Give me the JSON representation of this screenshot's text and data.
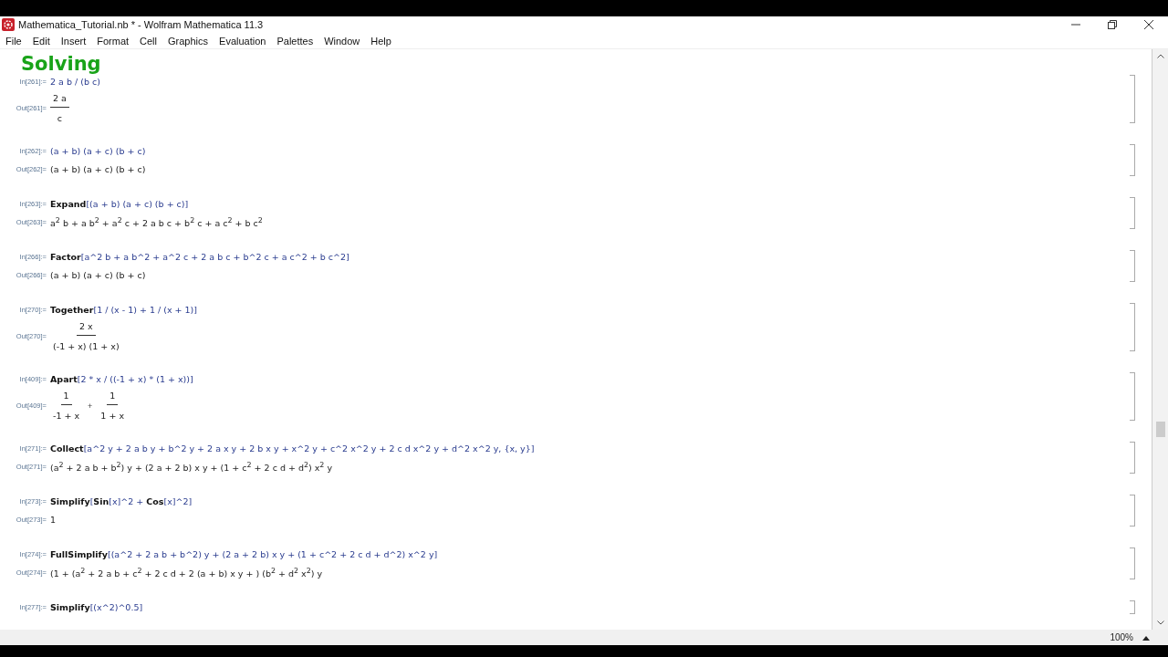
{
  "window": {
    "title": "Mathematica_Tutorial.nb * - Wolfram Mathematica 11.3"
  },
  "menu": [
    "File",
    "Edit",
    "Insert",
    "Format",
    "Cell",
    "Graphics",
    "Evaluation",
    "Palettes",
    "Window",
    "Help"
  ],
  "section_title": "Solving",
  "cells": [
    {
      "in_label": "In[261]:=",
      "input": [
        {
          "text": "2 a b / (b c)",
          "kind": "sym"
        }
      ],
      "out_label": "Out[261]=",
      "output": {
        "kind": "fractions",
        "terms": [
          {
            "num": "2 a",
            "den": "c"
          }
        ]
      }
    },
    {
      "in_label": "In[262]:=",
      "input": [
        {
          "text": "(a + b)  (a + c)  (b + c)",
          "kind": "sym"
        }
      ],
      "out_label": "Out[262]=",
      "output": {
        "kind": "line",
        "text": "(a + b) (a + c) (b + c)"
      }
    },
    {
      "in_label": "In[263]:=",
      "input": [
        {
          "text": "Expand",
          "kind": "func"
        },
        {
          "text": "[(a + b)  (a + c)  (b + c)]",
          "kind": "sym"
        }
      ],
      "out_label": "Out[263]=",
      "output": {
        "kind": "line",
        "text": "a$^{2}$ b + a b$^{2}$ + a$^{2}$ c + 2 a b c + b$^{2}$ c + a c$^{2}$ + b c$^{2}$"
      }
    },
    {
      "in_label": "In[266]:=",
      "input": [
        {
          "text": "Factor",
          "kind": "func"
        },
        {
          "text": "[a^2 b + a b^2 + a^2 c + 2 a b c + b^2 c + a c^2 + b c^2]",
          "kind": "sym"
        }
      ],
      "out_label": "Out[266]=",
      "output": {
        "kind": "line",
        "text": "(a + b) (a + c) (b + c)"
      }
    },
    {
      "in_label": "In[270]:=",
      "input": [
        {
          "text": "Together",
          "kind": "func"
        },
        {
          "text": "[1 / (x - 1) + 1 / (x + 1)]",
          "kind": "sym"
        }
      ],
      "out_label": "Out[270]=",
      "output": {
        "kind": "fractions",
        "terms": [
          {
            "num": "2 x",
            "den": "(-1 + x) (1 + x)"
          }
        ]
      }
    },
    {
      "in_label": "In[409]:=",
      "input": [
        {
          "text": "Apart",
          "kind": "func"
        },
        {
          "text": "[2 * x / ((-1 + x) * (1 + x))]",
          "kind": "sym"
        }
      ],
      "out_label": "Out[409]=",
      "output": {
        "kind": "fractions",
        "joiner": "+",
        "terms": [
          {
            "num": "1",
            "den": "-1 + x"
          },
          {
            "num": "1",
            "den": "1 + x"
          }
        ]
      }
    },
    {
      "in_label": "In[271]:=",
      "input": [
        {
          "text": "Collect",
          "kind": "func"
        },
        {
          "text": "[a^2 y + 2 a b y + b^2 y + 2 a x y + 2 b x y + x^2 y + c^2 x^2 y + 2 c d x^2 y + d^2 x^2 y, {x, y}]",
          "kind": "sym"
        }
      ],
      "out_label": "Out[271]=",
      "output": {
        "kind": "line",
        "text": "(a$^{2}$ + 2 a b + b$^{2}$) y + (2 a + 2 b) x y + (1 + c$^{2}$ + 2 c d + d$^{2}$) x$^{2}$ y"
      }
    },
    {
      "in_label": "In[273]:=",
      "input": [
        {
          "text": "Simplify",
          "kind": "func"
        },
        {
          "text": "[",
          "kind": "sym"
        },
        {
          "text": "Sin",
          "kind": "func"
        },
        {
          "text": "[x]^2 + ",
          "kind": "sym"
        },
        {
          "text": "Cos",
          "kind": "func"
        },
        {
          "text": "[x]^2]",
          "kind": "sym"
        }
      ],
      "out_label": "Out[273]=",
      "output": {
        "kind": "line",
        "text": "1"
      }
    },
    {
      "in_label": "In[274]:=",
      "input": [
        {
          "text": "FullSimplify",
          "kind": "func"
        },
        {
          "text": "[(a^2 + 2 a b + b^2) y + (2 a + 2 b) x y + (1 + c^2 + 2 c d + d^2) x^2 y]",
          "kind": "sym"
        }
      ],
      "out_label": "Out[274]=",
      "output": {
        "kind": "line",
        "text": "(1 + (a$^{2}$ + 2 a b + c$^{2}$ + 2 c d + 2 (a + b) x y + ) (b$^{2}$ + d$^{2}$ x$^{2}$) y"
      }
    },
    {
      "in_label": "In[277]:=",
      "input": [
        {
          "text": "Simplify",
          "kind": "func"
        },
        {
          "text": "[(x^2)^0.5]",
          "kind": "sym"
        }
      ]
    }
  ],
  "status_bar": {
    "zoom": "100%"
  }
}
